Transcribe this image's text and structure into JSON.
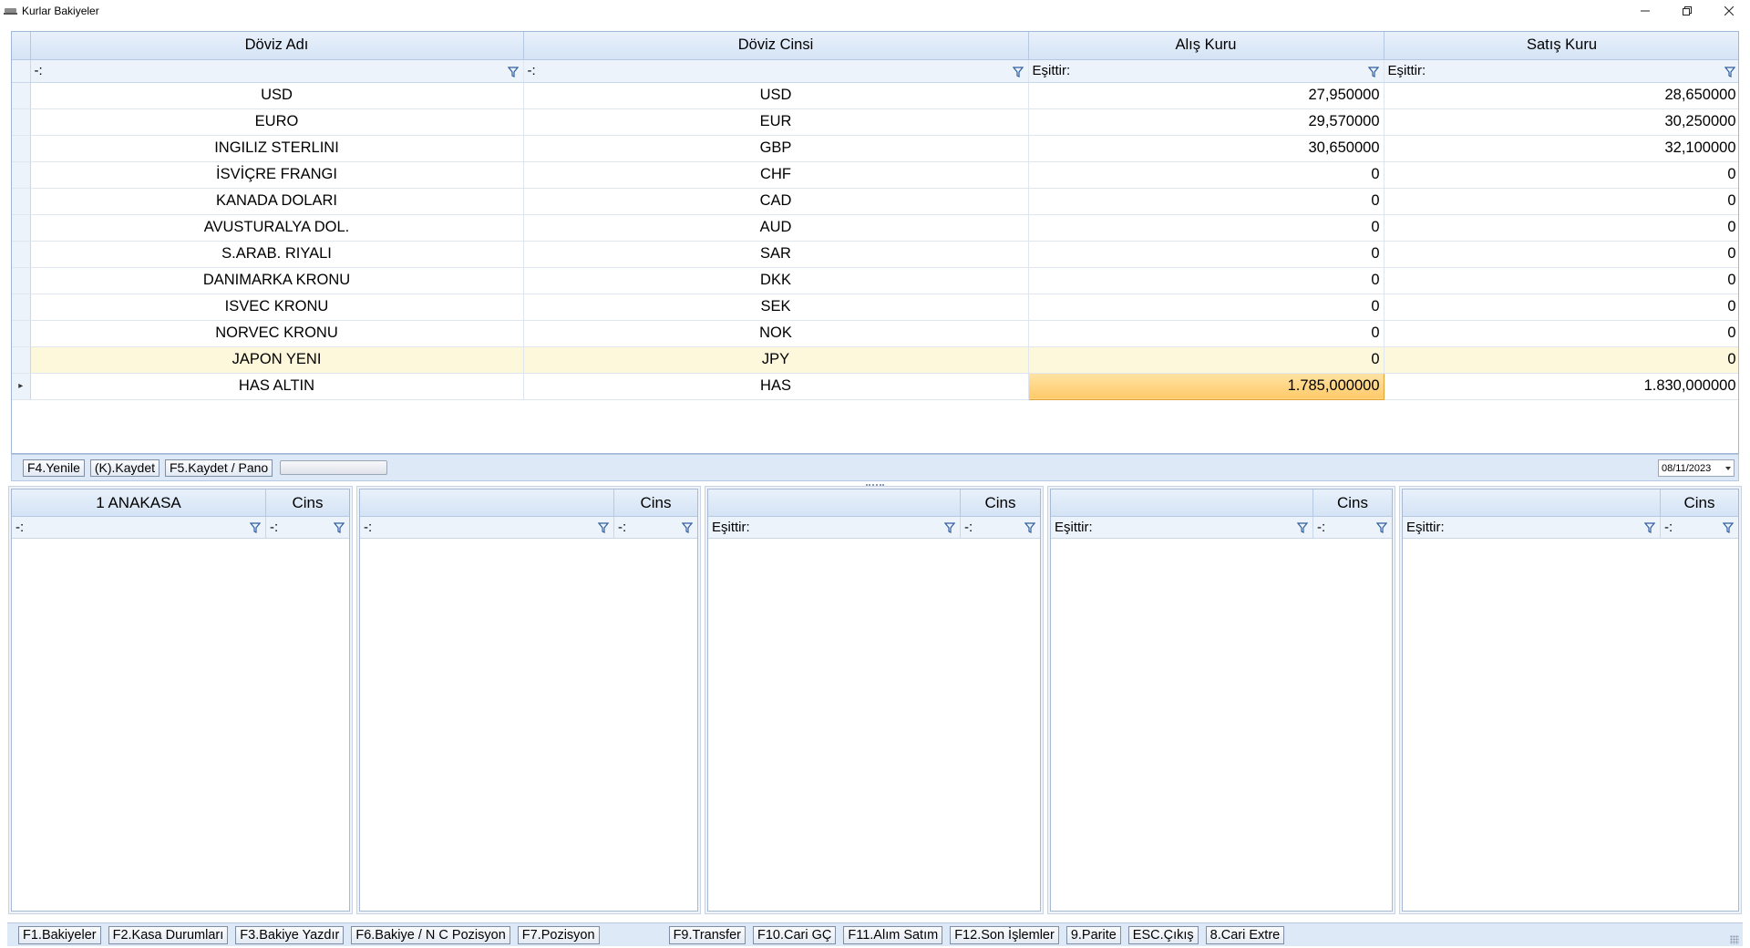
{
  "window": {
    "title": "Kurlar Bakiyeler"
  },
  "grid": {
    "columns": [
      "Döviz Adı",
      "Döviz Cinsi",
      "Alış Kuru",
      "Satış Kuru"
    ],
    "filters": [
      "-:",
      "-:",
      "Eşittir:",
      "Eşittir:"
    ],
    "rows": [
      {
        "name": "USD",
        "code": "USD",
        "buy": "27,950000",
        "sell": "28,650000"
      },
      {
        "name": "EURO",
        "code": "EUR",
        "buy": "29,570000",
        "sell": "30,250000"
      },
      {
        "name": "INGILIZ STERLINI",
        "code": "GBP",
        "buy": "30,650000",
        "sell": "32,100000"
      },
      {
        "name": "İSVİÇRE FRANGI",
        "code": "CHF",
        "buy": "0",
        "sell": "0"
      },
      {
        "name": "KANADA DOLARI",
        "code": "CAD",
        "buy": "0",
        "sell": "0"
      },
      {
        "name": "AVUSTURALYA DOL.",
        "code": "AUD",
        "buy": "0",
        "sell": "0"
      },
      {
        "name": "S.ARAB. RIYALI",
        "code": "SAR",
        "buy": "0",
        "sell": "0"
      },
      {
        "name": "DANIMARKA KRONU",
        "code": "DKK",
        "buy": "0",
        "sell": "0"
      },
      {
        "name": "ISVEC KRONU",
        "code": "SEK",
        "buy": "0",
        "sell": "0"
      },
      {
        "name": "NORVEC KRONU",
        "code": "NOK",
        "buy": "0",
        "sell": "0"
      },
      {
        "name": "JAPON YENI",
        "code": "JPY",
        "buy": "0",
        "sell": "0"
      },
      {
        "name": "HAS ALTIN",
        "code": "HAS",
        "buy": "1.785,000000",
        "sell": "1.830,000000"
      }
    ],
    "current_row_indicator": "▸"
  },
  "toolbar_top": {
    "refresh": "F4.Yenile",
    "save": "(K).Kaydet",
    "save_board": "F5.Kaydet / Pano",
    "date": "08/11/2023"
  },
  "panels": [
    {
      "title": "1 ANAKASA",
      "cins": "Cins",
      "filter_left": "-:",
      "filter_right": "-:"
    },
    {
      "title": "",
      "cins": "Cins",
      "filter_left": "-:",
      "filter_right": "-:"
    },
    {
      "title": "",
      "cins": "Cins",
      "filter_left": "Eşittir:",
      "filter_right": "-:"
    },
    {
      "title": "",
      "cins": "Cins",
      "filter_left": "Eşittir:",
      "filter_right": "-:"
    },
    {
      "title": "",
      "cins": "Cins",
      "filter_left": "Eşittir:",
      "filter_right": "-:"
    }
  ],
  "toolbar_bottom": {
    "left": [
      "F1.Bakiyeler",
      "F2.Kasa Durumları",
      "F3.Bakiye Yazdır",
      "F6.Bakiye / N C Pozisyon",
      "F7.Pozisyon"
    ],
    "right": [
      "F9.Transfer",
      "F10.Cari GÇ",
      "F11.Alım Satım",
      "F12.Son İşlemler",
      "9.Parite",
      "ESC.Çıkış",
      "8.Cari Extre"
    ]
  }
}
